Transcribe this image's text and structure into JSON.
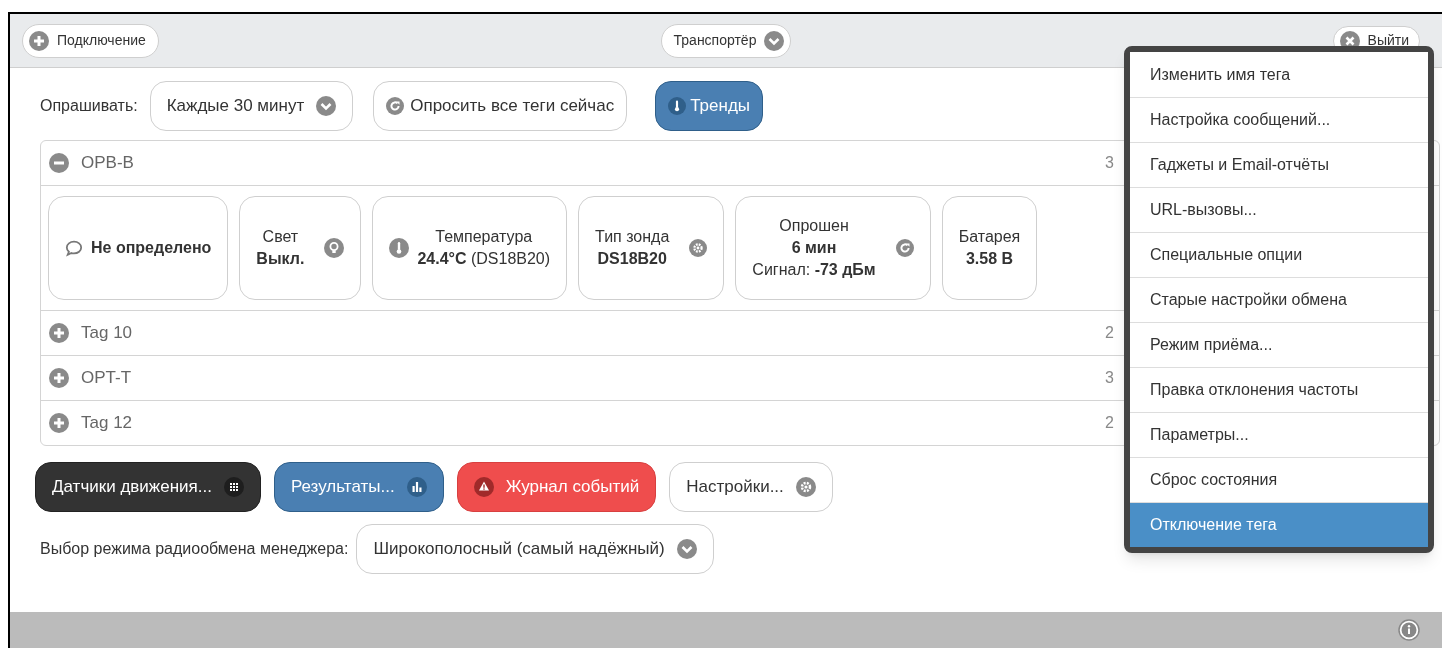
{
  "header": {
    "connect_button": "Подключение",
    "transport_button": "Транспортёр",
    "exit_button": "Выйти"
  },
  "poll": {
    "label": "Опрашивать:",
    "interval": "Каждые 30 минут",
    "poll_now": "Опросить все теги сейчас",
    "trends": "Тренды"
  },
  "tags": [
    {
      "name": "OPB-B",
      "expanded": true,
      "reading": "3",
      "cards": [
        {
          "kind": "status",
          "lines": [
            "**Не определено**"
          ]
        },
        {
          "kind": "light",
          "lines": [
            "Свет",
            "**Выкл.**"
          ]
        },
        {
          "kind": "temperature",
          "lines": [
            "Температура",
            "**24.4°C** (DS18B20)"
          ]
        },
        {
          "kind": "probe",
          "lines": [
            "Тип зонда",
            "**DS18B20**"
          ]
        },
        {
          "kind": "polled",
          "lines": [
            "Опрошен",
            "**6 мин**",
            "Сигнал: **-73 дБм**"
          ]
        },
        {
          "kind": "battery",
          "lines": [
            "Батарея",
            "**3.58 В**"
          ]
        }
      ]
    },
    {
      "name": "Tag 10",
      "expanded": false,
      "reading": "2"
    },
    {
      "name": "OPT-T",
      "expanded": false,
      "reading": "3"
    },
    {
      "name": "Tag 12",
      "expanded": false,
      "reading": "2"
    }
  ],
  "actions": [
    {
      "kind": "dark",
      "label": "Датчики движения..."
    },
    {
      "kind": "blue",
      "label": "Результаты..."
    },
    {
      "kind": "red",
      "label": "Журнал событий"
    },
    {
      "kind": "plain",
      "label": "Настройки..."
    }
  ],
  "radio_mode": {
    "label": "Выбор режима радиообмена менеджера:",
    "value": "Широкополосный (самый надёжный)"
  },
  "menu": [
    {
      "label": "Изменить имя тега",
      "selected": false
    },
    {
      "label": "Настройка сообщений...",
      "selected": false
    },
    {
      "label": "Гаджеты и Email-отчёты",
      "selected": false
    },
    {
      "label": "URL-вызовы...",
      "selected": false
    },
    {
      "label": "Специальные опции",
      "selected": false
    },
    {
      "label": "Старые настройки обмена",
      "selected": false
    },
    {
      "label": "Режим приёма...",
      "selected": false
    },
    {
      "label": "Правка отклонения частоты",
      "selected": false
    },
    {
      "label": "Параметры...",
      "selected": false
    },
    {
      "label": "Сброс состояния",
      "selected": false
    },
    {
      "label": "Отключение тега",
      "selected": true
    }
  ]
}
